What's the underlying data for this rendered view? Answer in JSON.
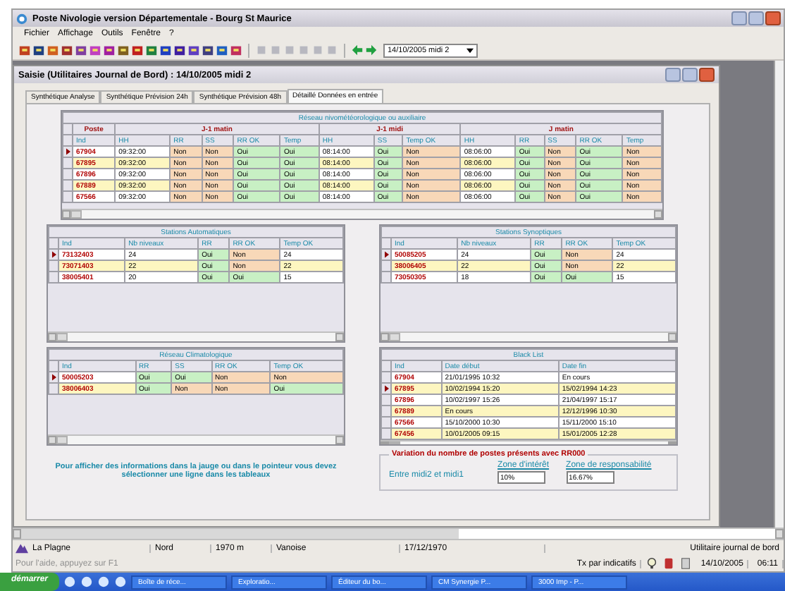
{
  "window": {
    "title": "Poste Nivologie version Départementale - Bourg St Maurice"
  },
  "menu": [
    "Fichier",
    "Affichage",
    "Outils",
    "Fenêtre",
    "?"
  ],
  "toolbar": {
    "date_select": "14/10/2005 midi 2"
  },
  "child_window": {
    "title": "Saisie (Utilitaires Journal de Bord) : 14/10/2005 midi 2"
  },
  "tabs": [
    {
      "label": "Synthétique Analyse",
      "selected": false
    },
    {
      "label": "Synthétique Prévision 24h",
      "selected": false
    },
    {
      "label": "Synthétique Prévision 48h",
      "selected": false
    },
    {
      "label": "Détaillé Données en entrée",
      "selected": true
    }
  ],
  "tables": [
    {
      "title": "Réseau nivométéorologique ou auxiliaire",
      "groups": [
        {
          "label": "Poste",
          "columns": [
            "Ind"
          ]
        },
        {
          "label": "J-1 matin",
          "columns": [
            "HH",
            "RR",
            "SS",
            "RR OK",
            "Temp"
          ]
        },
        {
          "label": "J-1 midi",
          "columns": [
            "HH",
            "SS",
            "Temp OK"
          ]
        },
        {
          "label": "J matin",
          "columns": [
            "HH",
            "RR",
            "SS",
            "RR OK",
            "Temp"
          ]
        }
      ],
      "rows": [
        {
          "selected": true,
          "cells": [
            {
              "text": "67904",
              "kind": "id"
            },
            {
              "text": "09:32:00",
              "kind": "plain"
            },
            {
              "text": "Non",
              "kind": "bad"
            },
            {
              "text": "Non",
              "kind": "bad"
            },
            {
              "text": "Oui",
              "kind": "ok"
            },
            {
              "text": "Oui",
              "kind": "ok"
            },
            {
              "text": "08:14:00",
              "kind": "plain"
            },
            {
              "text": "Oui",
              "kind": "ok"
            },
            {
              "text": "Non",
              "kind": "bad"
            },
            {
              "text": "08:06:00",
              "kind": "plain"
            },
            {
              "text": "Oui",
              "kind": "ok"
            },
            {
              "text": "Non",
              "kind": "bad"
            },
            {
              "text": "Oui",
              "kind": "ok"
            },
            {
              "text": "Non",
              "kind": "bad"
            }
          ]
        },
        {
          "selected": false,
          "cells": [
            {
              "text": "67895",
              "kind": "id"
            },
            {
              "text": "09:32:00",
              "kind": "plain"
            },
            {
              "text": "Non",
              "kind": "bad"
            },
            {
              "text": "Non",
              "kind": "bad"
            },
            {
              "text": "Oui",
              "kind": "ok"
            },
            {
              "text": "Oui",
              "kind": "ok"
            },
            {
              "text": "08:14:00",
              "kind": "plain"
            },
            {
              "text": "Oui",
              "kind": "ok"
            },
            {
              "text": "Non",
              "kind": "bad"
            },
            {
              "text": "08:06:00",
              "kind": "plain"
            },
            {
              "text": "Oui",
              "kind": "ok"
            },
            {
              "text": "Non",
              "kind": "bad"
            },
            {
              "text": "Oui",
              "kind": "ok"
            },
            {
              "text": "Non",
              "kind": "bad"
            }
          ]
        },
        {
          "selected": false,
          "cells": [
            {
              "text": "67896",
              "kind": "id"
            },
            {
              "text": "09:32:00",
              "kind": "plain"
            },
            {
              "text": "Non",
              "kind": "bad"
            },
            {
              "text": "Non",
              "kind": "bad"
            },
            {
              "text": "Oui",
              "kind": "ok"
            },
            {
              "text": "Oui",
              "kind": "ok"
            },
            {
              "text": "08:14:00",
              "kind": "plain"
            },
            {
              "text": "Oui",
              "kind": "ok"
            },
            {
              "text": "Non",
              "kind": "bad"
            },
            {
              "text": "08:06:00",
              "kind": "plain"
            },
            {
              "text": "Oui",
              "kind": "ok"
            },
            {
              "text": "Non",
              "kind": "bad"
            },
            {
              "text": "Oui",
              "kind": "ok"
            },
            {
              "text": "Non",
              "kind": "bad"
            }
          ]
        },
        {
          "selected": false,
          "cells": [
            {
              "text": "67889",
              "kind": "id"
            },
            {
              "text": "09:32:00",
              "kind": "plain"
            },
            {
              "text": "Non",
              "kind": "bad"
            },
            {
              "text": "Non",
              "kind": "bad"
            },
            {
              "text": "Oui",
              "kind": "ok"
            },
            {
              "text": "Oui",
              "kind": "ok"
            },
            {
              "text": "08:14:00",
              "kind": "plain"
            },
            {
              "text": "Oui",
              "kind": "ok"
            },
            {
              "text": "Non",
              "kind": "bad"
            },
            {
              "text": "08:06:00",
              "kind": "plain"
            },
            {
              "text": "Oui",
              "kind": "ok"
            },
            {
              "text": "Non",
              "kind": "bad"
            },
            {
              "text": "Oui",
              "kind": "ok"
            },
            {
              "text": "Non",
              "kind": "bad"
            }
          ]
        },
        {
          "selected": false,
          "cells": [
            {
              "text": "67566",
              "kind": "id"
            },
            {
              "text": "09:32:00",
              "kind": "plain"
            },
            {
              "text": "Non",
              "kind": "bad"
            },
            {
              "text": "Non",
              "kind": "bad"
            },
            {
              "text": "Oui",
              "kind": "ok"
            },
            {
              "text": "Oui",
              "kind": "ok"
            },
            {
              "text": "08:14:00",
              "kind": "plain"
            },
            {
              "text": "Oui",
              "kind": "ok"
            },
            {
              "text": "Non",
              "kind": "bad"
            },
            {
              "text": "08:06:00",
              "kind": "plain"
            },
            {
              "text": "Oui",
              "kind": "ok"
            },
            {
              "text": "Non",
              "kind": "bad"
            },
            {
              "text": "Oui",
              "kind": "ok"
            },
            {
              "text": "Non",
              "kind": "bad"
            }
          ]
        }
      ]
    },
    {
      "title": "Stations Automatiques",
      "columns": [
        "Ind",
        "Nb niveaux",
        "RR",
        "RR OK",
        "Temp OK"
      ],
      "rows": [
        {
          "selected": true,
          "cells": [
            {
              "text": "73132403",
              "kind": "id"
            },
            {
              "text": "24",
              "kind": "plain"
            },
            {
              "text": "Oui",
              "kind": "ok"
            },
            {
              "text": "Non",
              "kind": "bad"
            },
            {
              "text": "24",
              "kind": "plain"
            }
          ]
        },
        {
          "selected": false,
          "cells": [
            {
              "text": "73071403",
              "kind": "id"
            },
            {
              "text": "22",
              "kind": "plain"
            },
            {
              "text": "Oui",
              "kind": "ok"
            },
            {
              "text": "Non",
              "kind": "bad"
            },
            {
              "text": "22",
              "kind": "plain"
            }
          ]
        },
        {
          "selected": false,
          "cells": [
            {
              "text": "38005401",
              "kind": "id"
            },
            {
              "text": "20",
              "kind": "plain"
            },
            {
              "text": "Oui",
              "kind": "ok"
            },
            {
              "text": "Oui",
              "kind": "ok"
            },
            {
              "text": "15",
              "kind": "plain"
            }
          ]
        }
      ]
    },
    {
      "title": "Stations Synoptiques",
      "columns": [
        "Ind",
        "Nb niveaux",
        "RR",
        "RR OK",
        "Temp OK"
      ],
      "rows": [
        {
          "selected": true,
          "cells": [
            {
              "text": "50085205",
              "kind": "id"
            },
            {
              "text": "24",
              "kind": "plain"
            },
            {
              "text": "Oui",
              "kind": "ok"
            },
            {
              "text": "Non",
              "kind": "bad"
            },
            {
              "text": "24",
              "kind": "plain"
            }
          ]
        },
        {
          "selected": false,
          "cells": [
            {
              "text": "38006405",
              "kind": "id"
            },
            {
              "text": "22",
              "kind": "plain"
            },
            {
              "text": "Oui",
              "kind": "ok"
            },
            {
              "text": "Non",
              "kind": "bad"
            },
            {
              "text": "22",
              "kind": "plain"
            }
          ]
        },
        {
          "selected": false,
          "cells": [
            {
              "text": "73050305",
              "kind": "id"
            },
            {
              "text": "18",
              "kind": "plain"
            },
            {
              "text": "Oui",
              "kind": "ok"
            },
            {
              "text": "Oui",
              "kind": "ok"
            },
            {
              "text": "15",
              "kind": "plain"
            }
          ]
        }
      ]
    },
    {
      "title": "Réseau Climatologique",
      "columns": [
        "Ind",
        "RR",
        "SS",
        "RR OK",
        "Temp OK"
      ],
      "rows": [
        {
          "selected": true,
          "cells": [
            {
              "text": "50005203",
              "kind": "id"
            },
            {
              "text": "Oui",
              "kind": "ok"
            },
            {
              "text": "Oui",
              "kind": "ok"
            },
            {
              "text": "Non",
              "kind": "bad"
            },
            {
              "text": "Non",
              "kind": "bad"
            }
          ]
        },
        {
          "selected": false,
          "cells": [
            {
              "text": "38006403",
              "kind": "id"
            },
            {
              "text": "Oui",
              "kind": "ok"
            },
            {
              "text": "Non",
              "kind": "bad"
            },
            {
              "text": "Non",
              "kind": "bad"
            },
            {
              "text": "Oui",
              "kind": "ok"
            }
          ]
        }
      ]
    },
    {
      "title": "Black List",
      "columns": [
        "Ind",
        "Date début",
        "Date fin"
      ],
      "rows": [
        {
          "selected": false,
          "cells": [
            {
              "text": "67904",
              "kind": "id"
            },
            {
              "text": "21/01/1995 10:32",
              "kind": "plain"
            },
            {
              "text": "En cours",
              "kind": "plain"
            }
          ]
        },
        {
          "selected": true,
          "cells": [
            {
              "text": "67895",
              "kind": "id"
            },
            {
              "text": "10/02/1994 15:20",
              "kind": "plain"
            },
            {
              "text": "15/02/1994 14:23",
              "kind": "plain"
            }
          ]
        },
        {
          "selected": false,
          "cells": [
            {
              "text": "67896",
              "kind": "id"
            },
            {
              "text": "10/02/1997 15:26",
              "kind": "plain"
            },
            {
              "text": "21/04/1997 15:17",
              "kind": "plain"
            }
          ]
        },
        {
          "selected": false,
          "cells": [
            {
              "text": "67889",
              "kind": "id"
            },
            {
              "text": "En cours",
              "kind": "plain"
            },
            {
              "text": "12/12/1996 10:30",
              "kind": "plain"
            }
          ]
        },
        {
          "selected": false,
          "cells": [
            {
              "text": "67566",
              "kind": "id"
            },
            {
              "text": "15/10/2000 10:30",
              "kind": "plain"
            },
            {
              "text": "15/11/2000 15:10",
              "kind": "plain"
            }
          ]
        },
        {
          "selected": false,
          "cells": [
            {
              "text": "67456",
              "kind": "id"
            },
            {
              "text": "10/01/2005 09:15",
              "kind": "plain"
            },
            {
              "text": "15/01/2005 12:28",
              "kind": "plain"
            }
          ]
        }
      ]
    }
  ],
  "info_text": "Pour afficher des informations dans la jauge ou dans le pointeur vous devez sélectionner une ligne dans les tableaux",
  "variation": {
    "title": "Variation du nombre de postes présents avec RR000",
    "label": "Entre midi2 et midi1",
    "fields": [
      {
        "label": "Zone d'intérêt",
        "value": "10%"
      },
      {
        "label": "Zone de responsabilité",
        "value": "16.67%"
      }
    ]
  },
  "status_bar": {
    "fields": [
      "La Plagne",
      "Nord",
      "1970 m",
      "Vanoise",
      "17/12/1970",
      "Utilitaire journal de bord"
    ],
    "hint": "Pour l'aide, appuyez sur F1",
    "indicator": "Tx par indicatifs",
    "date": "14/10/2005",
    "time": "06:11"
  },
  "taskbar": {
    "start": "démarrer",
    "items": [
      "Boîte de réce...",
      "Exploratio...",
      "Éditeur du bo...",
      "CM Synergie P...",
      "3000 Imp - P..."
    ]
  }
}
